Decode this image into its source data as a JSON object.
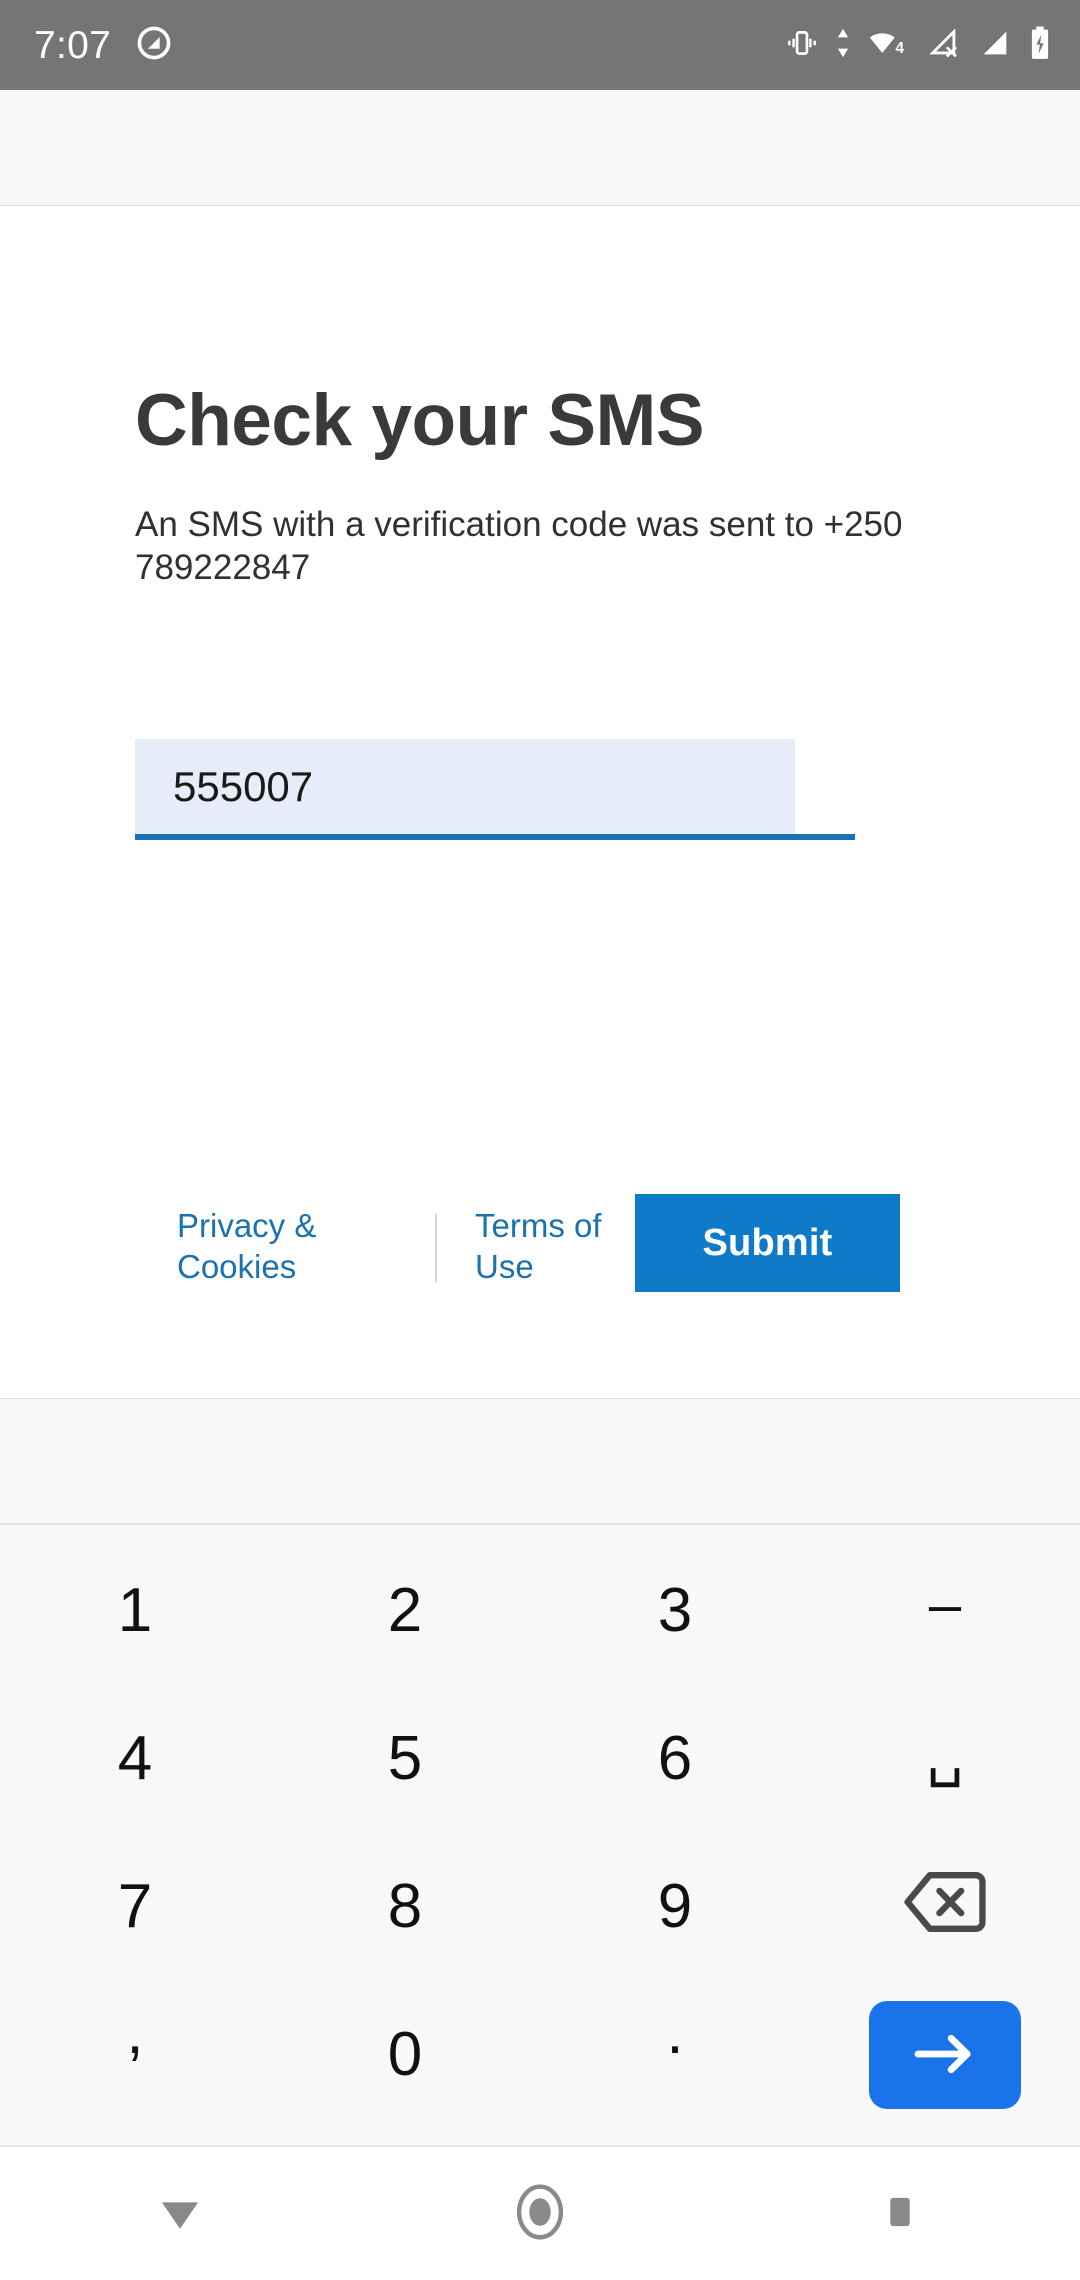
{
  "status_bar": {
    "time": "7:07",
    "left_icons": [
      {
        "name": "do-not-disturb-icon",
        "glyph": "⊘"
      }
    ],
    "right_icons": [
      {
        "name": "vibrate-icon"
      },
      {
        "name": "data-transfer-icon"
      },
      {
        "name": "wifi-icon",
        "badge": "4"
      },
      {
        "name": "no-sim-signal-icon"
      },
      {
        "name": "cellular-signal-icon"
      },
      {
        "name": "battery-charging-icon"
      }
    ],
    "background_color": "#757575",
    "foreground_color": "#ffffff"
  },
  "card": {
    "title": "Check your SMS",
    "subtitle": "An SMS with a verification code was sent to +250 789222847",
    "code_input": {
      "value": "555007",
      "placeholder": "Code",
      "highlight_color": "#e6ecf8",
      "underline_color": "#1a72b0"
    },
    "footer": {
      "privacy_link": "Privacy & Cookies",
      "terms_link": "Terms of Use",
      "submit_label": "Submit",
      "submit_color": "#0f7ac8",
      "link_color": "#1a72b0"
    }
  },
  "keyboard": {
    "background_color": "#f7f8fa",
    "enter_key_color": "#1a73e8",
    "rows": [
      [
        {
          "name": "key-1",
          "label": "1",
          "type": "digit"
        },
        {
          "name": "key-2",
          "label": "2",
          "type": "digit"
        },
        {
          "name": "key-3",
          "label": "3",
          "type": "digit"
        },
        {
          "name": "key-dash",
          "label": "–",
          "type": "symbol"
        }
      ],
      [
        {
          "name": "key-4",
          "label": "4",
          "type": "digit"
        },
        {
          "name": "key-5",
          "label": "5",
          "type": "digit"
        },
        {
          "name": "key-6",
          "label": "6",
          "type": "digit"
        },
        {
          "name": "key-space",
          "label": "␣",
          "type": "symbol"
        }
      ],
      [
        {
          "name": "key-7",
          "label": "7",
          "type": "digit"
        },
        {
          "name": "key-8",
          "label": "8",
          "type": "digit"
        },
        {
          "name": "key-9",
          "label": "9",
          "type": "digit"
        },
        {
          "name": "key-backspace",
          "label": "",
          "type": "backspace-icon"
        }
      ],
      [
        {
          "name": "key-comma",
          "label": ",",
          "type": "symbol"
        },
        {
          "name": "key-0",
          "label": "0",
          "type": "digit"
        },
        {
          "name": "key-period",
          "label": ".",
          "type": "symbol"
        },
        {
          "name": "key-enter",
          "label": "",
          "type": "enter-arrow-icon"
        }
      ]
    ]
  },
  "nav_bar": {
    "back_label": "back-triangle-icon",
    "home_label": "home-circle-icon",
    "recents_label": "recents-square-icon",
    "icon_color": "#8a8a8a"
  }
}
